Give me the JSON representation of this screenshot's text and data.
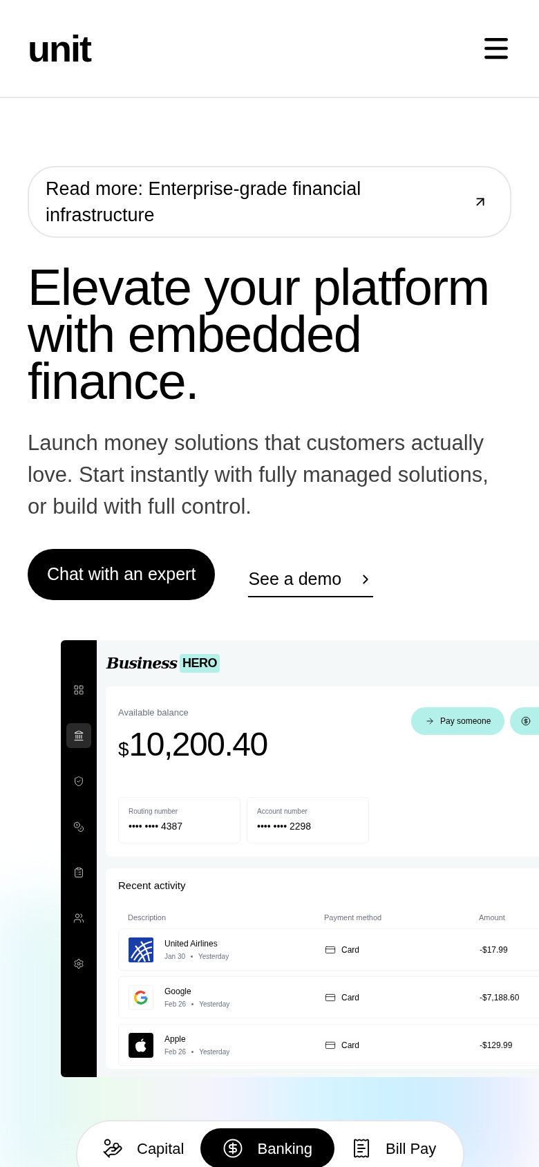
{
  "header": {
    "logo": "unit"
  },
  "announcement": {
    "text": "Read more: Enterprise-grade financial infrastructure"
  },
  "hero": {
    "headline": "Elevate your platform with embedded finance.",
    "body": "Launch money solutions that customers actually love. Start instantly with fully managed solutions, or build with full control.",
    "primary_button": "Chat with an expert",
    "secondary_link": "See a demo"
  },
  "dashboard": {
    "brand_script": "Business",
    "brand_badge": "HERO",
    "sidebar": [
      {
        "selected": false
      },
      {
        "selected": true
      },
      {
        "selected": false
      },
      {
        "selected": false
      },
      {
        "selected": false
      },
      {
        "selected": false
      },
      {
        "selected": false
      }
    ],
    "balance_label": "Available balance",
    "currency": "$",
    "balance": "10,200.40",
    "actions": [
      "Pay someone"
    ],
    "numbers": [
      {
        "label": "Routing number",
        "value": "•••• •••• 4387"
      },
      {
        "label": "Account number",
        "value": "•••• •••• 2298"
      }
    ],
    "activity": {
      "title": "Recent activity",
      "columns": [
        "Description",
        "Payment method",
        "Amount"
      ],
      "rows": [
        {
          "name": "United Airlines",
          "date": "Jan 30",
          "when": "Yesterday",
          "method": "Card",
          "amount": "-$17.99"
        },
        {
          "name": "Google",
          "date": "Feb 26",
          "when": "Yesterday",
          "method": "Card",
          "amount": "-$7,188.60"
        },
        {
          "name": "Apple",
          "date": "Feb 26",
          "when": "Yesterday",
          "method": "Card",
          "amount": "-$129.99"
        }
      ]
    }
  },
  "product_tabs": [
    {
      "label": "Capital",
      "selected": false
    },
    {
      "label": "Banking",
      "selected": true
    },
    {
      "label": "Bill Pay",
      "selected": false
    }
  ]
}
